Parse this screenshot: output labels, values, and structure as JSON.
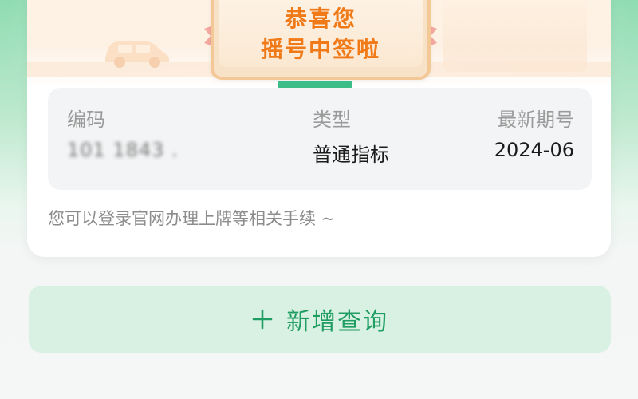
{
  "banner": {
    "line1": "恭喜您",
    "line2": "摇号中签啦"
  },
  "info": {
    "code_label": "编码",
    "code_value": "101 1843 .",
    "type_label": "类型",
    "type_value": "普通指标",
    "period_label": "最新期号",
    "period_value": "2024-06"
  },
  "hint": "您可以登录官网办理上牌等相关手续 ~",
  "add_button": {
    "label": "新增查询",
    "icon": "plus-icon"
  },
  "colors": {
    "accent_green": "#1f9d62",
    "banner_orange": "#f07a18",
    "button_bg": "#d8f1e2"
  }
}
